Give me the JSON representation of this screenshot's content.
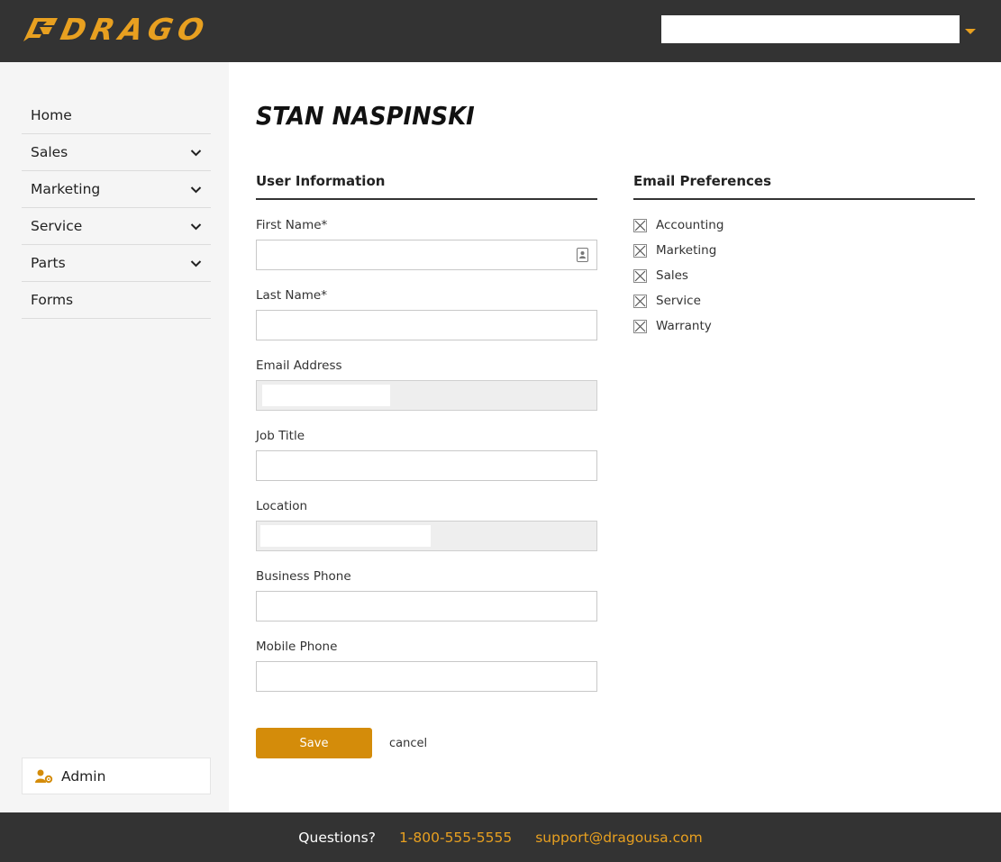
{
  "brand": {
    "logo_text": "DRAGO",
    "accent": "#e8a020",
    "button_color": "#d48c0a",
    "dark": "#333333"
  },
  "header": {
    "dealer_select_value": "",
    "caret_icon": "caret-down-icon"
  },
  "sidebar": {
    "items": [
      {
        "label": "Home",
        "has_submenu": false
      },
      {
        "label": "Sales",
        "has_submenu": true
      },
      {
        "label": "Marketing",
        "has_submenu": true
      },
      {
        "label": "Service",
        "has_submenu": true
      },
      {
        "label": "Parts",
        "has_submenu": true
      },
      {
        "label": "Forms",
        "has_submenu": false
      }
    ],
    "admin_label": "Admin",
    "admin_icon": "user-gear-icon"
  },
  "main": {
    "title": "STAN NASPINSKI",
    "user_info": {
      "heading": "User Information",
      "fields": {
        "first_name": {
          "label": "First Name*",
          "value": ""
        },
        "last_name": {
          "label": "Last Name*",
          "value": ""
        },
        "email": {
          "label": "Email Address",
          "value": "",
          "disabled": true
        },
        "job_title": {
          "label": "Job Title",
          "value": ""
        },
        "location": {
          "label": "Location",
          "value": "",
          "disabled": true
        },
        "business_phone": {
          "label": "Business Phone",
          "value": ""
        },
        "mobile_phone": {
          "label": "Mobile Phone",
          "value": ""
        }
      }
    },
    "email_prefs": {
      "heading": "Email Preferences",
      "options": [
        {
          "label": "Accounting",
          "checked": true
        },
        {
          "label": "Marketing",
          "checked": true
        },
        {
          "label": "Sales",
          "checked": true
        },
        {
          "label": "Service",
          "checked": true
        },
        {
          "label": "Warranty",
          "checked": true
        }
      ]
    },
    "actions": {
      "save_label": "Save",
      "cancel_label": "cancel"
    }
  },
  "footer": {
    "questions": "Questions?",
    "phone": "1-800-555-5555",
    "email": "support@dragousa.com"
  }
}
